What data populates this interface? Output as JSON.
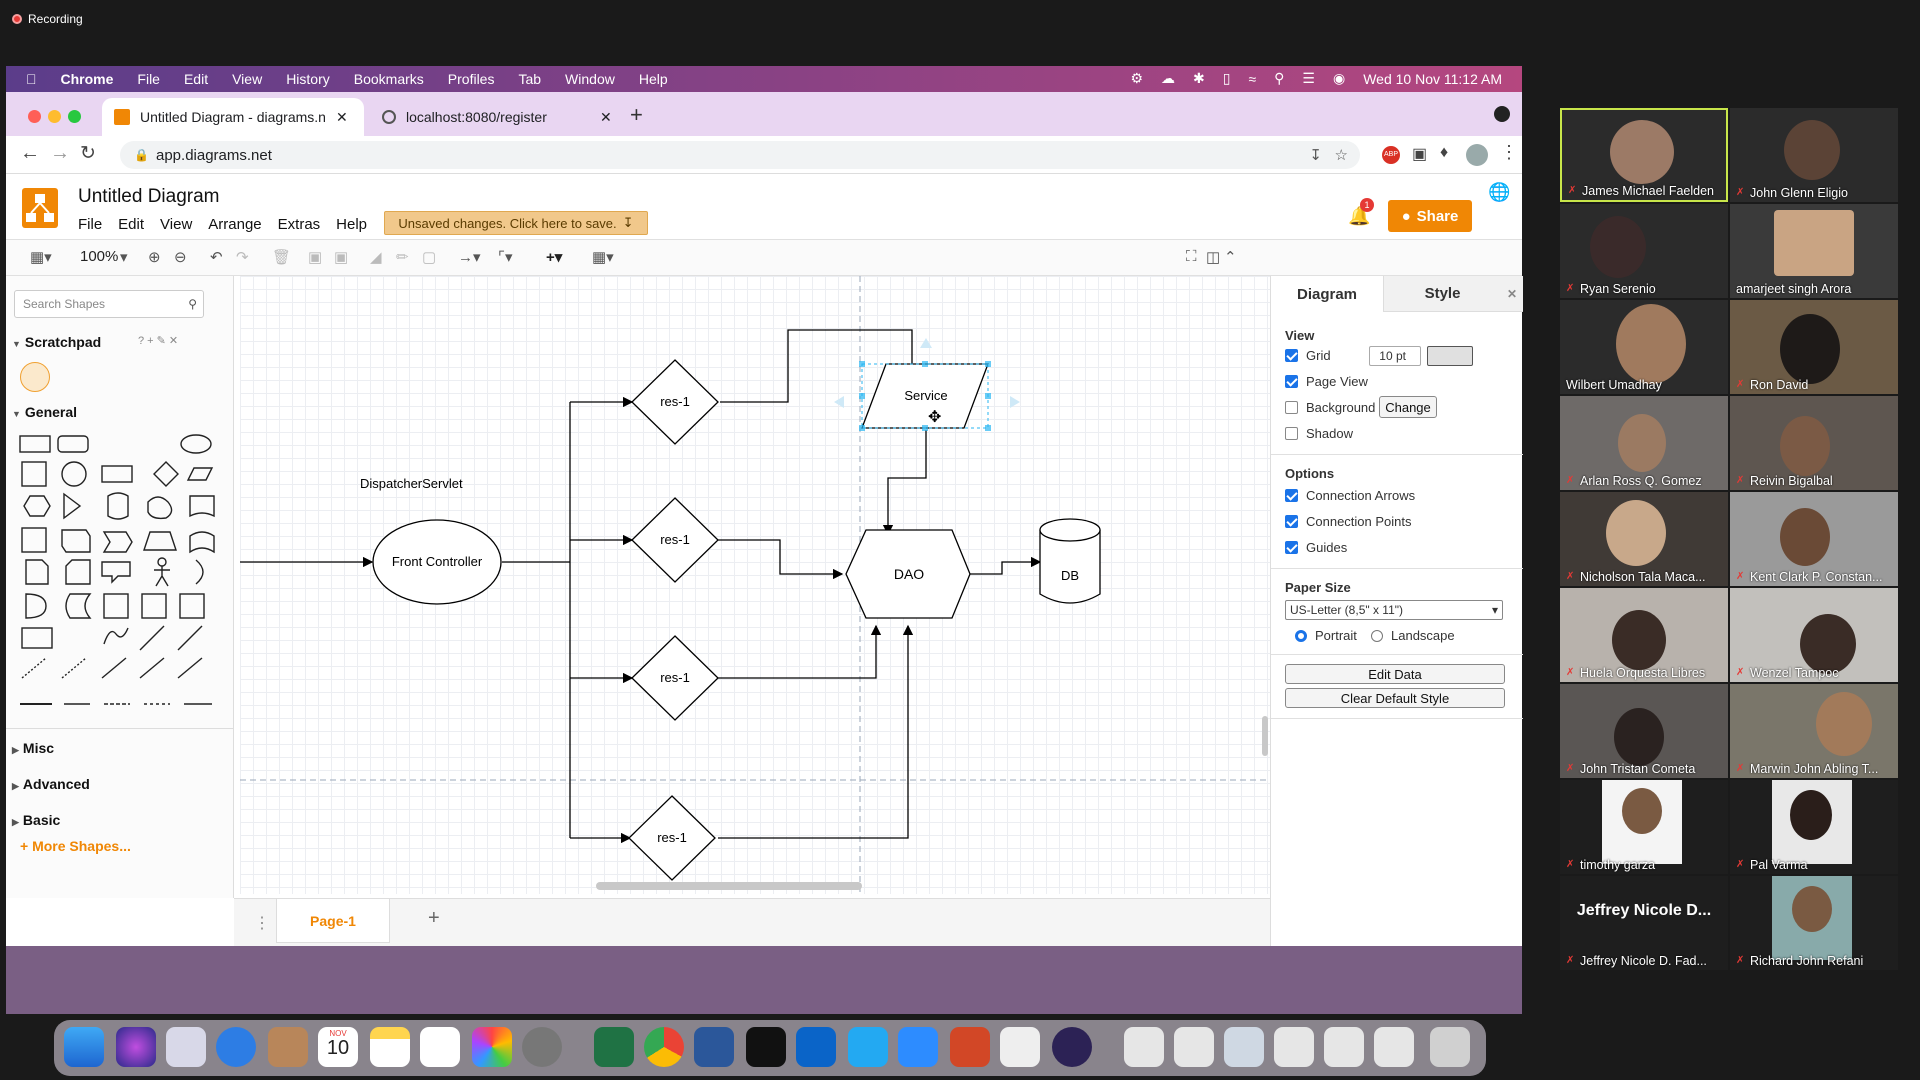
{
  "recording": "Recording",
  "menubar": {
    "apple": "",
    "items": [
      "Chrome",
      "File",
      "Edit",
      "View",
      "History",
      "Bookmarks",
      "Profiles",
      "Tab",
      "Window",
      "Help"
    ],
    "datetime": "Wed 10 Nov  11:12 AM"
  },
  "tabs": [
    {
      "title": "Untitled Diagram - diagrams.ne"
    },
    {
      "title": "localhost:8080/register"
    }
  ],
  "address": "app.diagrams.net",
  "app": {
    "title": "Untitled Diagram",
    "menus": [
      "File",
      "Edit",
      "View",
      "Arrange",
      "Extras",
      "Help"
    ],
    "unsaved": "Unsaved changes. Click here to save.",
    "share": "Share",
    "notif_count": "1",
    "zoom": "100%"
  },
  "left_panel": {
    "search_placeholder": "Search Shapes",
    "scratchpad": "Scratchpad",
    "general": "General",
    "misc": "Misc",
    "advanced": "Advanced",
    "basic": "Basic",
    "more_shapes": "+ More Shapes..."
  },
  "diagram": {
    "shapes": {
      "res1_a": "res-1",
      "res1_b": "res-1",
      "res1_c": "res-1",
      "res1_d": "res-1",
      "service": "Service",
      "dao": "DAO",
      "db": "DB",
      "front": "Front Controller",
      "dispatcher": "DispatcherServlet"
    }
  },
  "page_tab": "Page-1",
  "right_panel": {
    "tab_diagram": "Diagram",
    "tab_style": "Style",
    "view": "View",
    "grid": "Grid",
    "grid_size": "10 pt",
    "page_view": "Page View",
    "background": "Background",
    "change": "Change",
    "shadow": "Shadow",
    "options": "Options",
    "conn_arrows": "Connection Arrows",
    "conn_points": "Connection Points",
    "guides": "Guides",
    "paper_size": "Paper Size",
    "paper_value": "US-Letter (8,5\" x 11\")",
    "portrait": "Portrait",
    "landscape": "Landscape",
    "edit_data": "Edit Data",
    "clear_style": "Clear Default Style"
  },
  "dock_date": {
    "month": "NOV",
    "day": "10"
  },
  "participants": [
    "James Michael Faelden",
    "John Glenn Eligio",
    "Ryan Serenio",
    "amarjeet singh Arora",
    "Wilbert Umadhay",
    "Ron David",
    "Arlan Ross Q. Gomez",
    "Reivin Bigalbal",
    "Nicholson Tala Maca...",
    "Kent Clark P. Constan...",
    "Huela Orquesta Libres",
    "Wenzel Tampoc",
    "John Tristan Cometa",
    "Marwin John Abling T...",
    "timothy garza",
    "Pal Varma",
    "Jeffrey Nicole D. Fad...",
    "Richard John Refani"
  ],
  "big_name": "Jeffrey Nicole D...",
  "colors": {
    "accent": "#f08705",
    "menubar": "#6b3f8f",
    "selected": "#1a73e8"
  }
}
